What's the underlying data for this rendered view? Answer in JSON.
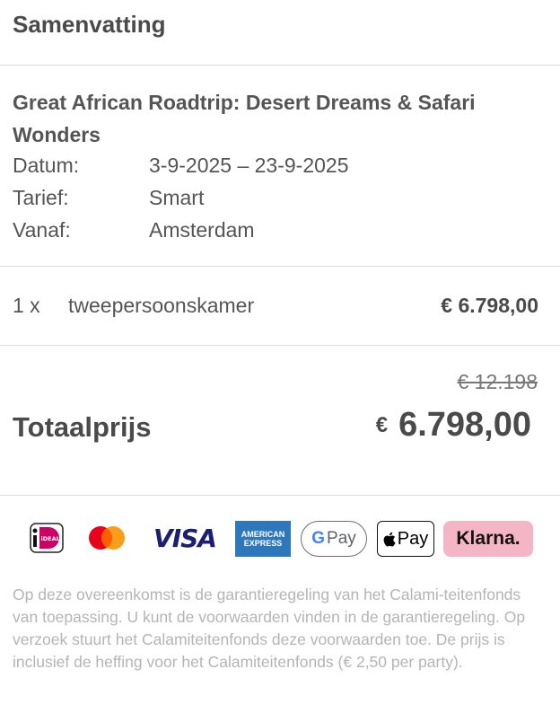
{
  "summary": {
    "heading": "Samenvatting",
    "trip_title": "Great African Roadtrip: Desert Dreams & Safari Wonders",
    "details": [
      {
        "label": "Datum:",
        "value": "3-9-2025 – 23-9-2025"
      },
      {
        "label": "Tarief:",
        "value": "Smart"
      },
      {
        "label": "Vanaf:",
        "value": "Amsterdam"
      }
    ]
  },
  "line_items": [
    {
      "qty": "1 x",
      "description": "tweepersoonskamer",
      "price": "€ 6.798,00"
    }
  ],
  "totals": {
    "old_price": "€ 12.198",
    "label": "Totaalprijs",
    "currency": "€",
    "amount": "6.798,00"
  },
  "payment_methods": {
    "ideal": "iDEAL",
    "visa": "VISA",
    "amex_line1": "AMERICAN",
    "amex_line2": "EXPRESS",
    "gpay": "Pay",
    "gpay_g": "G",
    "applepay": "Pay",
    "klarna": "Klarna."
  },
  "disclaimer": "Op deze overeenkomst is de garantieregeling van het Calami-teitenfonds van toepassing. U kunt de voorwaarden vinden in de garantieregeling. Op verzoek stuurt het Calamiteitenfonds deze voorwaarden toe. De prijs is inclusief de heffing voor het Calamiteitenfonds (€ 2,50 per party).",
  "colors": {
    "text": "#555555",
    "divider": "#dcdcdc",
    "disclaimer": "#b5b5b5",
    "visa": "#1a1f71",
    "amex": "#2e77bb",
    "klarna": "#f4b6c7"
  }
}
